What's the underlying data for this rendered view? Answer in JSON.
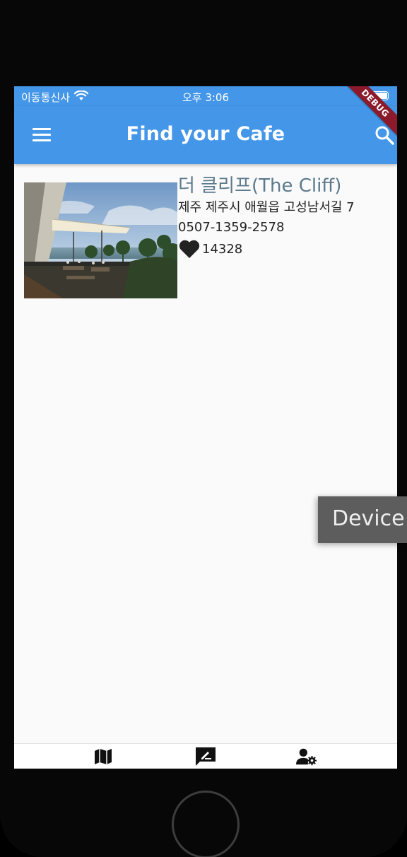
{
  "status_bar": {
    "carrier": "이동통신사",
    "time": "오후 3:06",
    "wifi_icon": "wifi-icon",
    "battery_icon": "battery-icon"
  },
  "app_bar": {
    "title": "Find your Cafe",
    "menu_icon": "menu-icon",
    "search_icon": "search-icon",
    "debug_banner": "DEBUG",
    "color": "#4496e8"
  },
  "cafes": [
    {
      "name": "더 클리프(The Cliff)",
      "address": "제주 제주시 애월읍 고성남서길 7",
      "phone": "0507-1359-2578",
      "likes": "14328",
      "heart_icon": "heart-icon"
    }
  ],
  "bottom_nav": [
    {
      "icon": "map-icon"
    },
    {
      "icon": "rate-review-icon"
    },
    {
      "icon": "manage-accounts-icon"
    }
  ],
  "toast": {
    "label": "Device"
  },
  "colors": {
    "cafe_name": "#5c7a8c",
    "debug_banner": "#8b1a2b",
    "background": "#fafafa"
  }
}
